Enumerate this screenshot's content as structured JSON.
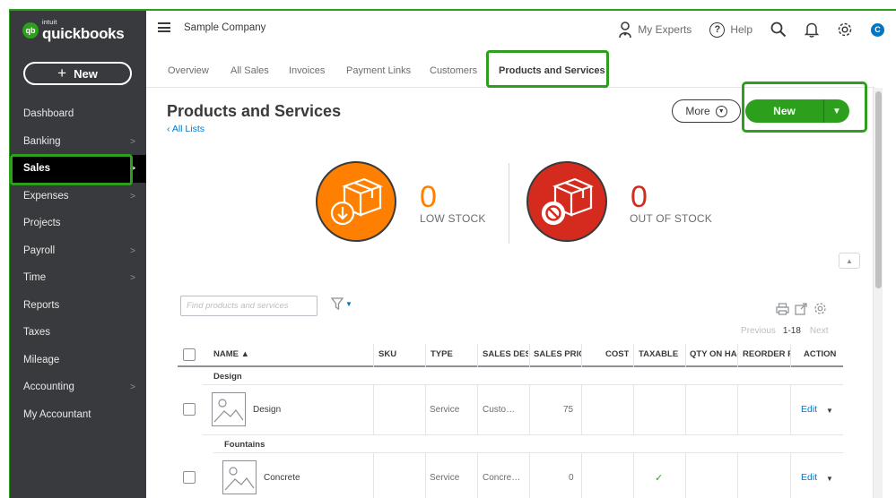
{
  "app": {
    "logo_intuit": "intuit",
    "logo_name": "quickbooks",
    "logo_badge": "qb",
    "company": "Sample Company",
    "new_label": "New"
  },
  "sidebar": {
    "items": [
      {
        "label": "Dashboard",
        "has_chevron": false
      },
      {
        "label": "Banking",
        "has_chevron": true
      },
      {
        "label": "Sales",
        "has_chevron": true,
        "active": true
      },
      {
        "label": "Expenses",
        "has_chevron": true
      },
      {
        "label": "Projects",
        "has_chevron": false
      },
      {
        "label": "Payroll",
        "has_chevron": true
      },
      {
        "label": "Time",
        "has_chevron": true
      },
      {
        "label": "Reports",
        "has_chevron": false
      },
      {
        "label": "Taxes",
        "has_chevron": false
      },
      {
        "label": "Mileage",
        "has_chevron": false
      },
      {
        "label": "Accounting",
        "has_chevron": true
      },
      {
        "label": "My Accountant",
        "has_chevron": false
      }
    ]
  },
  "header": {
    "my_experts": "My Experts",
    "help": "Help",
    "avatar_letter": "C",
    "icons": [
      "person-icon",
      "help-icon",
      "search-icon",
      "bell-icon",
      "gear-icon"
    ]
  },
  "tabs": [
    "Overview",
    "All Sales",
    "Invoices",
    "Payment Links",
    "Customers",
    "Products and Services"
  ],
  "active_tab": "Products and Services",
  "page": {
    "title": "Products and Services",
    "all_lists": "All Lists",
    "more_label": "More",
    "new_label": "New"
  },
  "stock": {
    "low_count": "0",
    "low_label": "LOW STOCK",
    "out_count": "0",
    "out_label": "OUT OF STOCK"
  },
  "table_tools": {
    "search_placeholder": "Find products and services",
    "pager_prev": "Previous",
    "pager_range": "1-18",
    "pager_next": "Next"
  },
  "table": {
    "headers": [
      "NAME ▲",
      "SKU",
      "TYPE",
      "SALES DESC",
      "SALES PRIC",
      "COST",
      "TAXABLE",
      "QTY ON HA",
      "REORDER P",
      "ACTION"
    ],
    "groups": [
      {
        "name": "Design",
        "rows": [
          {
            "name": "Design",
            "sku": "",
            "type": "Service",
            "sales_desc": "Custo…",
            "sales_price": "75",
            "cost": "",
            "taxable": false,
            "qty": "",
            "reorder": "",
            "action": "Edit"
          }
        ]
      },
      {
        "name": "Fountains",
        "rows": [
          {
            "name": "Concrete",
            "sku": "",
            "type": "Service",
            "sales_desc": "Concre…",
            "sales_price": "0",
            "cost": "",
            "taxable": true,
            "qty": "",
            "reorder": "",
            "action": "Edit"
          }
        ]
      }
    ]
  },
  "colors": {
    "sidebar_bg": "#393a3d",
    "brand_green": "#2ca01c",
    "low_stock_orange": "#ff8000",
    "out_stock_red": "#d52b1e",
    "link_blue": "#0077c5"
  }
}
